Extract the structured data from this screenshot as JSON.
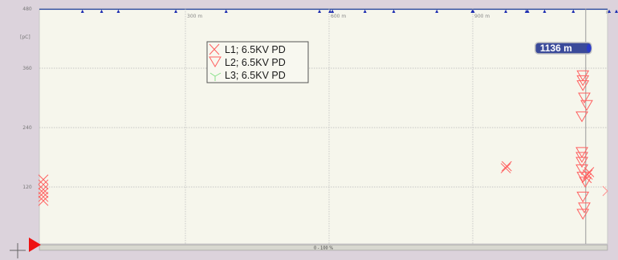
{
  "chart_data": {
    "type": "scatter",
    "y_unit": "[pC]",
    "ylim": [
      0,
      480
    ],
    "y_ticks": [
      "480",
      "360",
      "240",
      "120"
    ],
    "xlim": [
      0,
      1200
    ],
    "distance_labels": [
      "300 m",
      "600 m",
      "900 m"
    ],
    "distance_values": [
      300,
      600,
      900
    ],
    "end_label": "n",
    "cursor": {
      "label": "1136 m",
      "x": 1136
    },
    "scroll_label": "0 - 100 %",
    "grid": true,
    "legend_position": "top-center",
    "series": [
      {
        "name": "L1; 6.5KV PD",
        "marker": "x",
        "color": "#ff6060",
        "points": [
          [
            0,
            135
          ],
          [
            0,
            125
          ],
          [
            0,
            115
          ],
          [
            0,
            108
          ],
          [
            0,
            100
          ],
          [
            0,
            92
          ],
          [
            971,
            162
          ],
          [
            969,
            158
          ],
          [
            1143,
            150
          ],
          [
            1140,
            145
          ],
          [
            1138,
            138
          ]
        ]
      },
      {
        "name": "L2; 6.5KV PD",
        "marker": "triangle-down",
        "color": "#ff6060",
        "points": [
          [
            1130,
            345
          ],
          [
            1130,
            335
          ],
          [
            1130,
            325
          ],
          [
            1133,
            300
          ],
          [
            1138,
            285
          ],
          [
            1128,
            262
          ],
          [
            1128,
            190
          ],
          [
            1128,
            180
          ],
          [
            1128,
            170
          ],
          [
            1128,
            155
          ],
          [
            1130,
            140
          ],
          [
            1135,
            130
          ],
          [
            1130,
            100
          ],
          [
            1133,
            78
          ],
          [
            1130,
            65
          ]
        ]
      },
      {
        "name": "L3; 6.5KV PD",
        "marker": "y",
        "color": "#88e088",
        "points": []
      }
    ],
    "top_markers_x": [
      85,
      125,
      160,
      280,
      385,
      580,
      602,
      607,
      675,
      735,
      825,
      899,
      901,
      969,
      1012,
      1015,
      1050,
      1110,
      1185,
      1200
    ]
  }
}
